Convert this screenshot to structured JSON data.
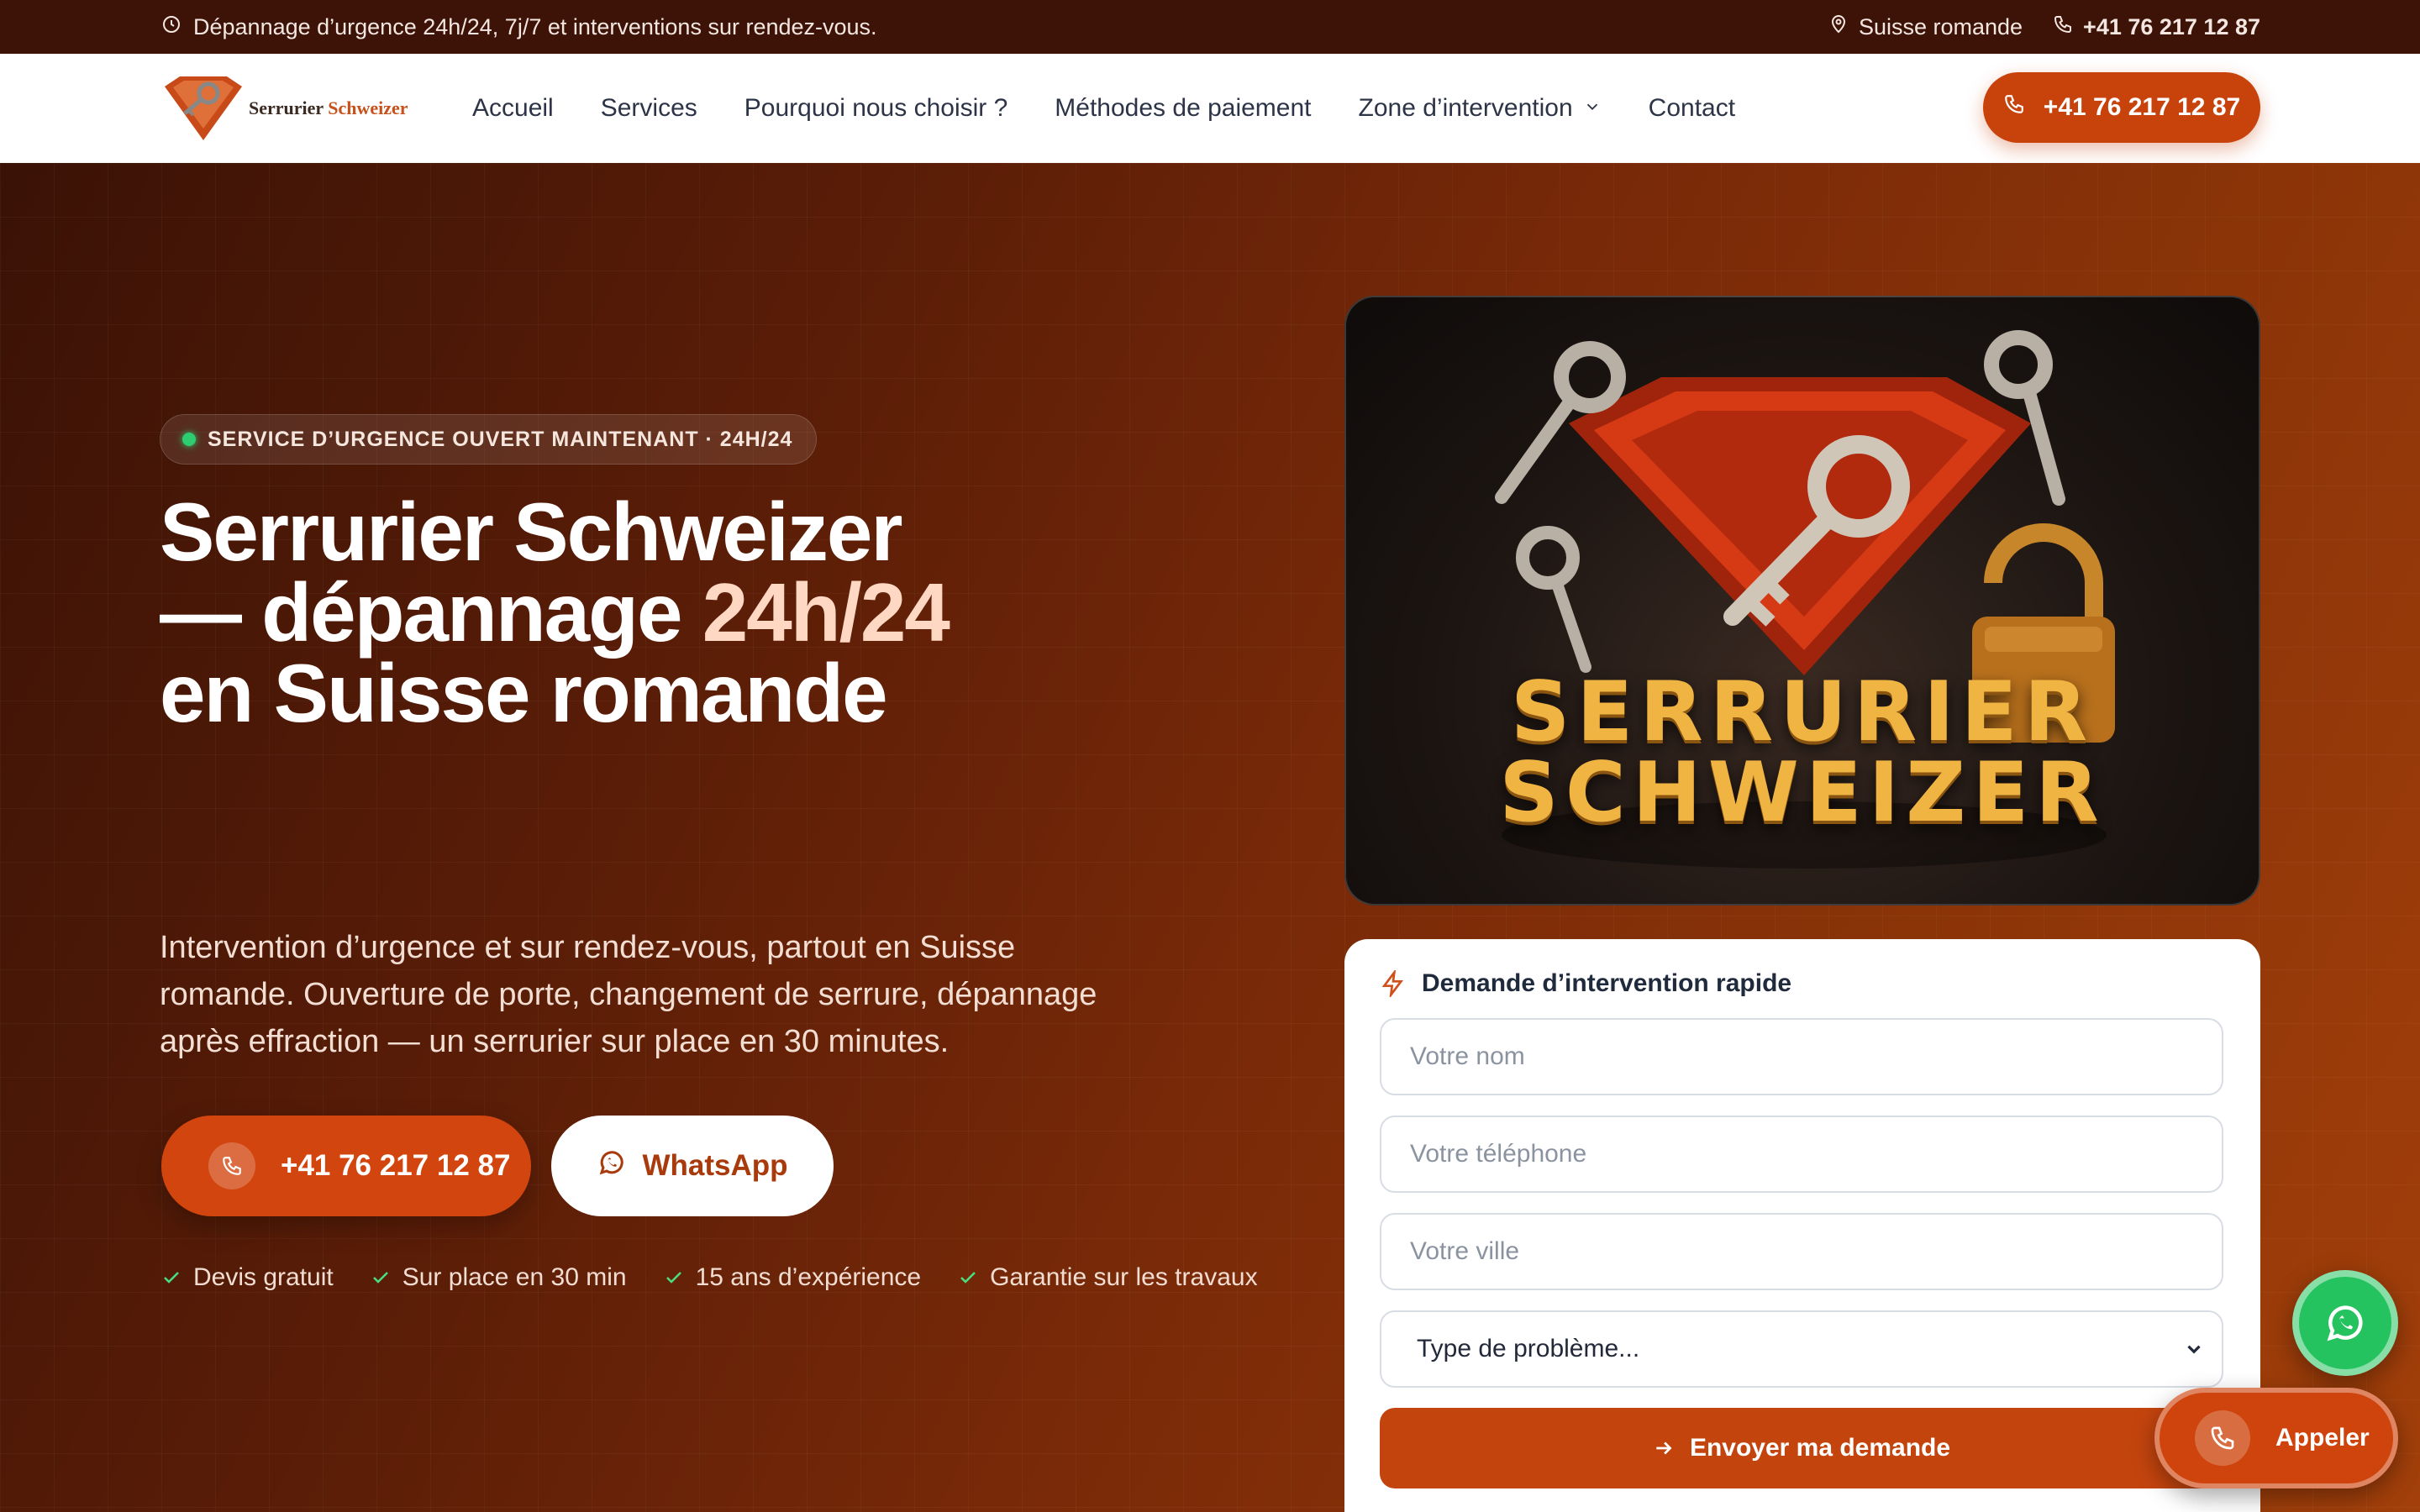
{
  "topbar": {
    "notice": "Dépannage d’urgence 24h/24, 7j/7 et interventions sur rendez-vous.",
    "region": "Suisse romande",
    "phone": "+41 76 217 12 87"
  },
  "header": {
    "logo": {
      "word1": "Serrurier",
      "word2": "Schweizer"
    },
    "nav": [
      {
        "label": "Accueil"
      },
      {
        "label": "Services"
      },
      {
        "label": "Pourquoi nous choisir ?"
      },
      {
        "label": "Méthodes de paiement"
      },
      {
        "label": "Zone d’intervention"
      },
      {
        "label": "Contact"
      }
    ],
    "call_label": "+41 76 217 12 87"
  },
  "hero": {
    "badge": "SERVICE D’URGENCE OUVERT MAINTENANT · 24H/24",
    "headline": {
      "line1": "Serrurier Schweizer",
      "line2_a": "— dépannage ",
      "line2_b": "24h/24",
      "line3": "en Suisse romande"
    },
    "lead": "Intervention d’urgence et sur rendez-vous, partout en Suisse romande. Ouverture de porte, changement de serrure, dépannage après effraction — un serrurier sur place en 30 minutes.",
    "phone_button": "+41 76 217 12 87",
    "whatsapp_button": "WhatsApp",
    "checks": [
      "Devis gratuit",
      "Sur place en 30 min",
      "15 ans d’expérience",
      "Garantie sur les travaux"
    ]
  },
  "image_card": {
    "line1": "SERRURIER",
    "line2": "SCHWEIZER"
  },
  "form": {
    "title": "Demande d’intervention rapide",
    "name_placeholder": "Votre nom",
    "phone_placeholder": "Votre téléphone",
    "city_placeholder": "Votre ville",
    "problem_select": "Type de problème...",
    "submit": "Envoyer ma demande"
  },
  "floating": {
    "call_label": "Appeler"
  },
  "colors": {
    "brand": "#c8420c",
    "topbar": "#3d1307",
    "whatsapp": "#25c35f",
    "accent_text": "#ffd8c4"
  }
}
